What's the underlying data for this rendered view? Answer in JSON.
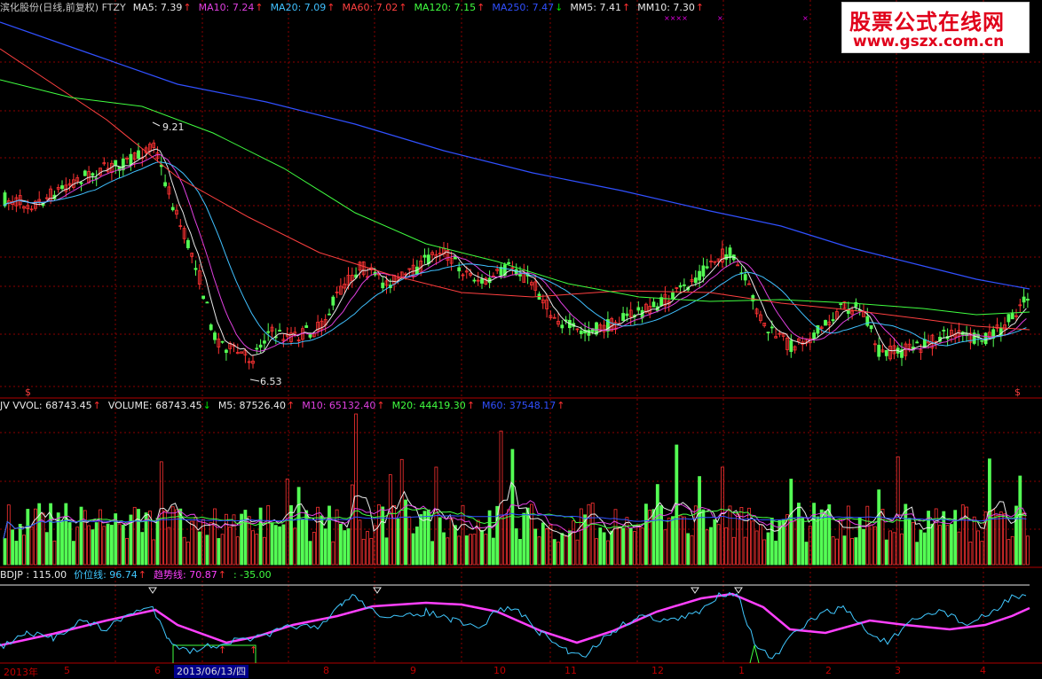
{
  "price_panel": {
    "items": [
      {
        "text": "滨化股份(日线,前复权) FTZY",
        "color": "#c8c8c8",
        "arrow": ""
      },
      {
        "text": "MA5: 7.39",
        "color": "#e8e8e8",
        "arrow": "↑",
        "arrow_color": "#ff3030"
      },
      {
        "text": "MA10: 7.24",
        "color": "#e040e0",
        "arrow": "↑",
        "arrow_color": "#ff3030"
      },
      {
        "text": "MA20: 7.09",
        "color": "#40c0ff",
        "arrow": "↑",
        "arrow_color": "#ff3030"
      },
      {
        "text": "MA60: 7.02",
        "color": "#ff4040",
        "arrow": "↑",
        "arrow_color": "#ff3030"
      },
      {
        "text": "MA120: 7.15",
        "color": "#40ff40",
        "arrow": "↑",
        "arrow_color": "#ff3030"
      },
      {
        "text": "MA250: 7.47",
        "color": "#3050ff",
        "arrow": "↓",
        "arrow_color": "#00e000"
      },
      {
        "text": "MM5: 7.41",
        "color": "#e8e8e8",
        "arrow": "↑",
        "arrow_color": "#ff3030"
      },
      {
        "text": "MM10: 7.30",
        "color": "#e8e8e8",
        "arrow": "↑",
        "arrow_color": "#ff3030"
      }
    ],
    "high_label": "9.21",
    "low_label": "6.53",
    "marks": [
      "××××",
      "×",
      "×"
    ]
  },
  "volume_panel": {
    "items": [
      {
        "text": "JV VVOL: 68743.45",
        "color": "#e8e8e8",
        "arrow": "↑",
        "arrow_color": "#ff3030"
      },
      {
        "text": "VOLUME: 68743.45",
        "color": "#e8e8e8",
        "arrow": "↓",
        "arrow_color": "#00e000"
      },
      {
        "text": "M5: 87526.40",
        "color": "#e8e8e8",
        "arrow": "↑",
        "arrow_color": "#ff3030"
      },
      {
        "text": "M10: 65132.40",
        "color": "#e040e0",
        "arrow": "↑",
        "arrow_color": "#ff3030"
      },
      {
        "text": "M20: 44419.30",
        "color": "#40ff40",
        "arrow": "↑",
        "arrow_color": "#ff3030"
      },
      {
        "text": "M60: 37548.17",
        "color": "#3050ff",
        "arrow": "↑",
        "arrow_color": "#ff3030"
      }
    ]
  },
  "indicator_panel": {
    "items": [
      {
        "text": "BDJP : 115.00",
        "color": "#e8e8e8",
        "arrow": ""
      },
      {
        "text": "价位线: 96.74",
        "color": "#40c8ff",
        "arrow": "↑",
        "arrow_color": "#ff3030"
      },
      {
        "text": "趋势线: 70.87",
        "color": "#ff40ff",
        "arrow": "↑",
        "arrow_color": "#ff3030"
      },
      {
        "text": ": -35.00",
        "color": "#40ff40",
        "arrow": ""
      }
    ]
  },
  "logo": {
    "line1": "股票公式在线网",
    "line2": "www.gszx.com.cn"
  },
  "time_axis": {
    "labels": [
      "2013年",
      "5",
      "6",
      "8",
      "9",
      "10",
      "11",
      "12",
      "1",
      "2",
      "3",
      "4"
    ],
    "selected_date": "2013/06/13/四"
  },
  "colors": {
    "up": "#ff3232",
    "down": "#54ff54",
    "grid": "#8b0000",
    "bg": "#000000"
  }
}
